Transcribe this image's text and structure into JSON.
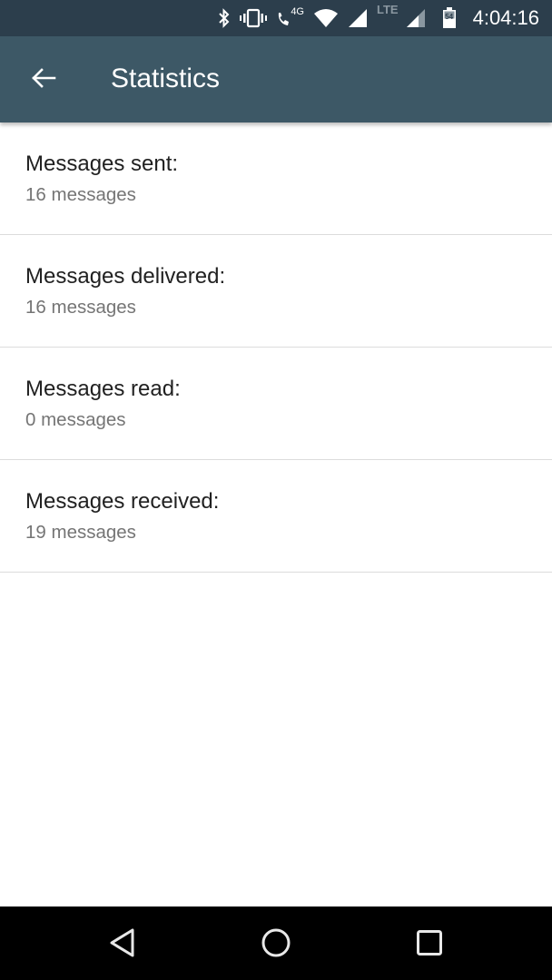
{
  "status_bar": {
    "time": "4:04:16",
    "battery_level": "54",
    "network_label_1": "4G",
    "network_label_2": "LTE",
    "icons": [
      "bluetooth-icon",
      "vibrate-icon",
      "wifi-call-icon",
      "wifi-icon",
      "signal-icon",
      "signal-icon",
      "battery-icon"
    ]
  },
  "toolbar": {
    "title": "Statistics",
    "back_icon": "arrow-left-icon"
  },
  "stats": [
    {
      "label": "Messages sent:",
      "value": "16 messages"
    },
    {
      "label": "Messages delivered:",
      "value": "16 messages"
    },
    {
      "label": "Messages read:",
      "value": "0 messages"
    },
    {
      "label": "Messages received:",
      "value": "19 messages"
    }
  ],
  "nav_bar": {
    "icons": [
      "back-triangle-icon",
      "home-circle-icon",
      "recents-square-icon"
    ]
  }
}
